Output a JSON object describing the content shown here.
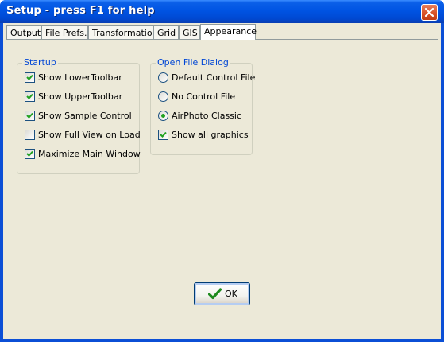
{
  "window": {
    "title": "Setup - press F1 for help"
  },
  "tabs": [
    {
      "label": "Output"
    },
    {
      "label": "File Prefs."
    },
    {
      "label": "Transformation"
    },
    {
      "label": "Grid"
    },
    {
      "label": "GIS"
    },
    {
      "label": "Appearance"
    }
  ],
  "active_tab": "Appearance",
  "startup": {
    "title": "Startup",
    "options": [
      {
        "label": "Show LowerToolbar",
        "checked": true
      },
      {
        "label": "Show UpperToolbar",
        "checked": true
      },
      {
        "label": "Show Sample Control",
        "checked": true
      },
      {
        "label": "Show Full View on Load",
        "checked": false
      },
      {
        "label": "Maximize Main Window",
        "checked": true
      }
    ]
  },
  "open_file_dialog": {
    "title": "Open File Dialog",
    "radios": [
      {
        "label": "Default Control File",
        "selected": false
      },
      {
        "label": "No Control File",
        "selected": false
      },
      {
        "label": "AirPhoto Classic",
        "selected": true
      }
    ],
    "checkbox": {
      "label": "Show all graphics",
      "checked": true
    }
  },
  "ok_button": {
    "label": "OK"
  },
  "colors": {
    "titlebar": "#0054e3",
    "dialog_bg": "#ece9d8",
    "group_title": "#0046d5",
    "check_mark": "#21a121"
  }
}
